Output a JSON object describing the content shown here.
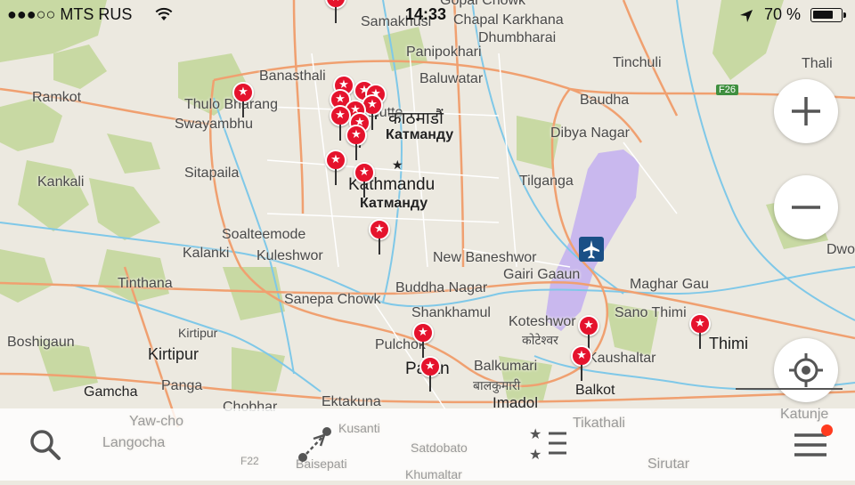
{
  "status_bar": {
    "carrier": "●●●○○ MTS RUS",
    "time": "14:33",
    "battery": "70 %"
  },
  "map": {
    "labels": {
      "ramkot": "Ramkot",
      "thulo_bharang": "Thulo Bharang",
      "swayambhu": "Swayambhu",
      "banasthali": "Banasthali",
      "sorakhutte": "Sorakhutte",
      "sitapaila": "Sitapaila",
      "kankali": "Kankali",
      "samakhusi": "Samakhusi",
      "panipokhari": "Panipokhari",
      "baluwatar": "Baluwatar",
      "gopal_chowk": "Gopal Chowk",
      "chapal_karkhana": "Chapal Karkhana",
      "dhumbharai": "Dhumbharai",
      "tinchuli": "Tinchuli",
      "thali": "Thali",
      "f26": "F26",
      "baudha": "Baudha",
      "kathmandu_np": "काठमाडौं",
      "kathmandu_ru1": "Катманду",
      "kathmandu": "Kathmandu",
      "kathmandu_ru2": "Катманду",
      "dibya_nagar": "Dibya Nagar",
      "tilganga": "Tilganga",
      "soalteemode": "Soalteemode",
      "kalanki": "Kalanki",
      "kuleshwor": "Kuleshwor",
      "tinthana": "Tinthana",
      "new_baneshwor": "New Baneshwor",
      "gairi_gaaun": "Gairi Gaaun",
      "dwo": "Dwo",
      "sanepa_chowk": "Sanepa Chowk",
      "buddha_nagar": "Buddha Nagar",
      "maghar_gau": "Maghar Gau",
      "shankhamul": "Shankhamul",
      "boshigaun": "Boshigaun",
      "kirtipur_small": "Kirtipur",
      "kirtipur": "Kirtipur",
      "pulchok": "Pulchok",
      "patan": "Patan",
      "koteshwor": "Koteshwor",
      "koteshwor_np": "कोटेश्वर",
      "sano_thimi": "Sano Thimi",
      "thimi": "Thimi",
      "kaushaltar": "Kaushaltar",
      "balkumari": "Balkumari",
      "balkumari_np": "बालकुमारी",
      "balkot": "Balkot",
      "gamcha": "Gamcha",
      "panga": "Panga",
      "chobhar": "Chobhar",
      "ektakuna": "Ektakuna",
      "imadol": "Imadol",
      "katunje": "Katunje",
      "yaw_cho": "Yaw-cho",
      "langocha": "Langocha",
      "kusanti": "Kusanti",
      "satdobato": "Satdobato",
      "tikathali": "Tikathali",
      "khumaltar": "Khumaltar",
      "baisepati": "Baisepati",
      "sirutar": "Sirutar",
      "f22": "F22"
    }
  },
  "controls": {
    "zoom_in": "+",
    "zoom_out": "−"
  },
  "toolbar": {
    "search": "search",
    "route": "route",
    "bookmarks": "bookmarks",
    "menu": "menu"
  },
  "colors": {
    "pin": "#e5132d",
    "airport": "#c9b8ee",
    "park": "#c8d9a3",
    "water": "#7fc8e8",
    "road": "#f0a070"
  }
}
